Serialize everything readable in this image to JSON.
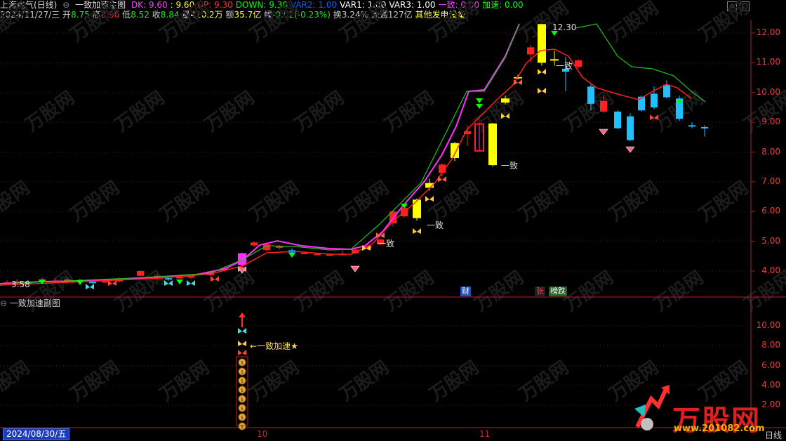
{
  "header": {
    "stock_name": "上海电气(日线)",
    "indicator_name": "一致加速主图",
    "values": [
      {
        "label": "DK: 9.60",
        "color": "#ff40ff"
      },
      {
        "label": ": 9.60",
        "color": "#ffff00"
      },
      {
        "label": "UP: 9.30",
        "color": "#ff3030"
      },
      {
        "label": "DOWN: 9.30",
        "color": "#00ff00"
      },
      {
        "label": "VAR2: 1.00",
        "color": "#0060ff"
      },
      {
        "label": "VAR1: 1.00",
        "color": "#ffffff"
      },
      {
        "label": "VAR3: 1.00",
        "color": "#ffffff"
      },
      {
        "label": "一致: 0.00",
        "color": "#ff40ff"
      },
      {
        "label": "加速: 0.00",
        "color": "#00ff00"
      }
    ]
  },
  "quote": {
    "date": "2024/11/27/三",
    "open_label": "开",
    "open": "8.75",
    "high_label": "高",
    "high": "8.90",
    "low_label": "低",
    "low": "8.52",
    "close_label": "收",
    "close": "8.84",
    "volume_label": "量",
    "volume": "410.2万",
    "amount_label": "额",
    "amount": "35.7亿",
    "change_label": "幅",
    "change": "-0.02(-0.23%)",
    "turnover_label": "换",
    "turnover": "3.24%",
    "float_label": "流通",
    "float": "127亿",
    "sector": "其他发电设备"
  },
  "price_axis": [
    "12.00",
    "11.00",
    "10.00",
    "9.00",
    "8.00",
    "7.00",
    "6.00",
    "5.00",
    "4.00"
  ],
  "sub_axis": [
    "10.00",
    "8.00",
    "6.00",
    "4.00",
    "2.00"
  ],
  "annotations": {
    "high_price": "12.30",
    "low_price": "3.58",
    "yizhi": "一致",
    "sub_label": "一致加速",
    "star": "★",
    "cai": "财",
    "zhang": "张",
    "bang": "榜跌"
  },
  "sub_panel": {
    "title": "一致加速副图"
  },
  "x_axis": {
    "cursor_date": "2024/08/30/五",
    "labels": [
      "10",
      "11"
    ],
    "period": "日线"
  },
  "watermark": {
    "brand": "万股网",
    "url": "www.201082.com"
  },
  "colors": {
    "up": "#ff2020",
    "down": "#20c0ff",
    "yellow": "#ffff00",
    "magenta": "#ff30ff",
    "green": "#00ff00",
    "axis": "#b02020"
  }
}
